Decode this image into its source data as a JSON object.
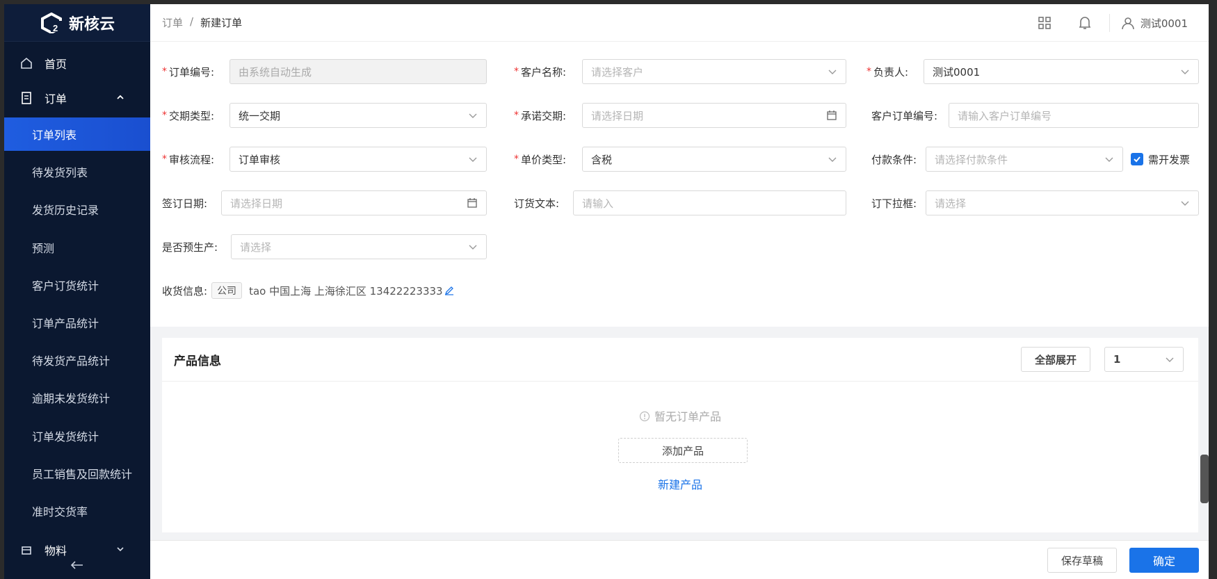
{
  "logo": {
    "text": "新核云"
  },
  "sidebar": {
    "home": "首页",
    "orders_group": "订单",
    "items": [
      {
        "label": "订单列表",
        "active": true
      },
      {
        "label": "待发货列表"
      },
      {
        "label": "发货历史记录"
      },
      {
        "label": "预测"
      },
      {
        "label": "客户订货统计"
      },
      {
        "label": "订单产品统计"
      },
      {
        "label": "待发货产品统计"
      },
      {
        "label": "逾期未发货统计"
      },
      {
        "label": "订单发货统计"
      },
      {
        "label": "员工销售及回款统计"
      },
      {
        "label": "准时交货率"
      }
    ],
    "materials_group": "物料",
    "collapse_icon": "collapse-left-icon"
  },
  "header": {
    "breadcrumb_root": "订单",
    "breadcrumb_sep": "/",
    "breadcrumb_current": "新建订单",
    "user": "测试0001"
  },
  "form": {
    "order_no": {
      "label": "订单编号:",
      "placeholder": "由系统自动生成"
    },
    "customer": {
      "label": "客户名称:",
      "placeholder": "请选择客户"
    },
    "owner": {
      "label": "负责人:",
      "value": "测试0001"
    },
    "delivery_type": {
      "label": "交期类型:",
      "value": "统一交期"
    },
    "promise_date": {
      "label": "承诺交期:",
      "placeholder": "请选择日期"
    },
    "customer_order_no": {
      "label": "客户订单编号:",
      "placeholder": "请输入客户订单编号"
    },
    "approval_flow": {
      "label": "审核流程:",
      "value": "订单审核"
    },
    "price_type": {
      "label": "单价类型:",
      "value": "含税"
    },
    "payment_terms": {
      "label": "付款条件:",
      "placeholder": "请选择付款条件"
    },
    "invoice": {
      "label": "需开发票",
      "checked": true
    },
    "sign_date": {
      "label": "签订日期:",
      "placeholder": "请选择日期"
    },
    "order_text": {
      "label": "订货文本:",
      "placeholder": "请输入"
    },
    "dropdown": {
      "label": "订下拉框:",
      "placeholder": "请选择"
    },
    "preproduction": {
      "label": "是否预生产:",
      "placeholder": "请选择"
    },
    "shipping": {
      "label": "收货信息:",
      "tag": "公司",
      "address": "tao 中国上海 上海徐汇区 13422223333"
    }
  },
  "products": {
    "title": "产品信息",
    "expand_all": "全部展开",
    "page_select": "1",
    "empty_text": "暂无订单产品",
    "add_product": "添加产品",
    "new_product": "新建产品"
  },
  "footer": {
    "save_draft": "保存草稿",
    "confirm": "确定"
  },
  "colors": {
    "primary": "#1a73e8",
    "sidebar": "#0b1830",
    "required": "#e33"
  }
}
